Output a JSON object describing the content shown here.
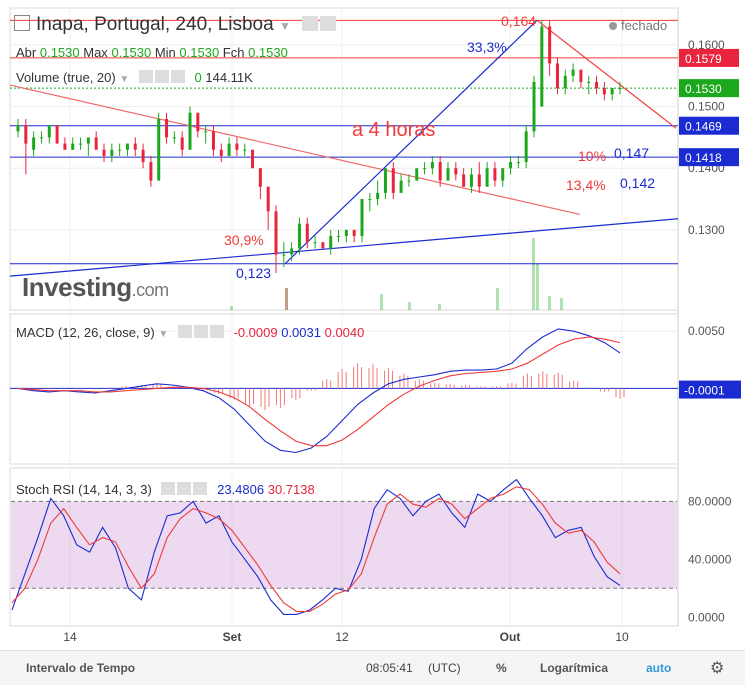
{
  "header": {
    "title": "Inapa, Portugal, 240, Lisboa",
    "status": "fechado",
    "ohlc": {
      "abr_label": "Abr",
      "abr": "0.1530",
      "max_label": "Max",
      "max": "0.1530",
      "min_label": "Min",
      "min": "0.1530",
      "fch_label": "Fch",
      "fch": "0.1530"
    },
    "volume_label": "Volume (true, 20)",
    "volume_v1": "0",
    "volume_v2": "144.11K"
  },
  "annotations": {
    "period_text": "a 4 horas",
    "peak": "0,164",
    "rise_pct": "33,3%",
    "drop_pct": "30,9%",
    "low": "0,123",
    "pct10": "10%",
    "lvl147": "0,147",
    "pct134": "13,4%",
    "lvl142": "0,142"
  },
  "logo": {
    "brand": "Investing",
    "suffix": ".com"
  },
  "price_axis": {
    "ticks": [
      "0.1600",
      "0.1500",
      "0.1400",
      "0.1300"
    ],
    "badges": [
      {
        "label": "0.1579",
        "color": "#e8253c"
      },
      {
        "label": "0.1530",
        "color": "#1ca81c"
      },
      {
        "label": "0.1469",
        "color": "#1a2bd1"
      },
      {
        "label": "0.1418",
        "color": "#1a2bd1"
      }
    ]
  },
  "macd": {
    "label": "MACD (12, 26, close, 9)",
    "v1": "-0.0009",
    "v2": "0.0031",
    "v3": "0.0040",
    "ticks": [
      "0.0050"
    ],
    "badge": "-0.0001"
  },
  "stoch": {
    "label": "Stoch RSI (14, 14, 3, 3)",
    "v1": "23.4806",
    "v2": "30.7138",
    "ticks": [
      "80.0000",
      "40.0000",
      "0.0000"
    ]
  },
  "time_axis": {
    "ticks": [
      "14",
      "Set",
      "12",
      "Out",
      "10"
    ]
  },
  "bottom_bar": {
    "interval": "Intervalo de Tempo",
    "time": "08:05:41",
    "tz": "(UTC)",
    "pct": "%",
    "log": "Logarítmica",
    "auto": "auto"
  },
  "colors": {
    "up": "#1ca81c",
    "down": "#e8253c",
    "blue": "#1a2bd1",
    "red": "#f03a3a"
  },
  "chart_data": [
    {
      "type": "candlestick",
      "name": "price",
      "ylim": [
        0.117,
        0.166
      ],
      "candles": [
        [
          0.146,
          0.148,
          0.145,
          0.147
        ],
        [
          0.147,
          0.148,
          0.139,
          0.144
        ],
        [
          0.143,
          0.146,
          0.142,
          0.145
        ],
        [
          0.145,
          0.146,
          0.144,
          0.145
        ],
        [
          0.145,
          0.147,
          0.144,
          0.147
        ],
        [
          0.147,
          0.147,
          0.144,
          0.144
        ],
        [
          0.144,
          0.145,
          0.143,
          0.143
        ],
        [
          0.143,
          0.145,
          0.143,
          0.144
        ],
        [
          0.144,
          0.145,
          0.143,
          0.144
        ],
        [
          0.144,
          0.145,
          0.142,
          0.145
        ],
        [
          0.145,
          0.146,
          0.143,
          0.143
        ],
        [
          0.143,
          0.144,
          0.141,
          0.142
        ],
        [
          0.142,
          0.144,
          0.141,
          0.143
        ],
        [
          0.143,
          0.144,
          0.142,
          0.143
        ],
        [
          0.143,
          0.144,
          0.142,
          0.144
        ],
        [
          0.144,
          0.145,
          0.142,
          0.143
        ],
        [
          0.143,
          0.144,
          0.14,
          0.141
        ],
        [
          0.141,
          0.142,
          0.137,
          0.138
        ],
        [
          0.138,
          0.149,
          0.138,
          0.148
        ],
        [
          0.148,
          0.149,
          0.144,
          0.145
        ],
        [
          0.145,
          0.146,
          0.144,
          0.145
        ],
        [
          0.145,
          0.146,
          0.142,
          0.143
        ],
        [
          0.143,
          0.15,
          0.143,
          0.149
        ],
        [
          0.149,
          0.149,
          0.145,
          0.146
        ],
        [
          0.146,
          0.147,
          0.144,
          0.146
        ],
        [
          0.146,
          0.147,
          0.142,
          0.143
        ],
        [
          0.143,
          0.144,
          0.141,
          0.142
        ],
        [
          0.142,
          0.145,
          0.142,
          0.144
        ],
        [
          0.144,
          0.145,
          0.142,
          0.143
        ],
        [
          0.143,
          0.144,
          0.142,
          0.143
        ],
        [
          0.143,
          0.143,
          0.14,
          0.14
        ],
        [
          0.14,
          0.14,
          0.135,
          0.137
        ],
        [
          0.137,
          0.137,
          0.13,
          0.133
        ],
        [
          0.133,
          0.134,
          0.123,
          0.126
        ],
        [
          0.126,
          0.128,
          0.124,
          0.126
        ],
        [
          0.126,
          0.128,
          0.125,
          0.127
        ],
        [
          0.127,
          0.132,
          0.126,
          0.131
        ],
        [
          0.131,
          0.132,
          0.127,
          0.128
        ],
        [
          0.128,
          0.129,
          0.127,
          0.128
        ],
        [
          0.128,
          0.128,
          0.127,
          0.127
        ],
        [
          0.127,
          0.13,
          0.126,
          0.129
        ],
        [
          0.129,
          0.13,
          0.128,
          0.129
        ],
        [
          0.129,
          0.13,
          0.128,
          0.13
        ],
        [
          0.13,
          0.13,
          0.128,
          0.129
        ],
        [
          0.129,
          0.135,
          0.128,
          0.135
        ],
        [
          0.135,
          0.136,
          0.133,
          0.135
        ],
        [
          0.135,
          0.138,
          0.134,
          0.136
        ],
        [
          0.136,
          0.14,
          0.135,
          0.14
        ],
        [
          0.14,
          0.141,
          0.135,
          0.136
        ],
        [
          0.136,
          0.139,
          0.136,
          0.138
        ],
        [
          0.138,
          0.139,
          0.137,
          0.138
        ],
        [
          0.138,
          0.14,
          0.138,
          0.14
        ],
        [
          0.14,
          0.141,
          0.139,
          0.14
        ],
        [
          0.14,
          0.142,
          0.139,
          0.141
        ],
        [
          0.141,
          0.142,
          0.137,
          0.138
        ],
        [
          0.138,
          0.141,
          0.138,
          0.14
        ],
        [
          0.14,
          0.141,
          0.138,
          0.139
        ],
        [
          0.139,
          0.14,
          0.137,
          0.137
        ],
        [
          0.137,
          0.14,
          0.136,
          0.139
        ],
        [
          0.139,
          0.141,
          0.136,
          0.137
        ],
        [
          0.137,
          0.141,
          0.137,
          0.14
        ],
        [
          0.14,
          0.141,
          0.137,
          0.138
        ],
        [
          0.138,
          0.14,
          0.137,
          0.14
        ],
        [
          0.14,
          0.142,
          0.139,
          0.141
        ],
        [
          0.141,
          0.142,
          0.14,
          0.141
        ],
        [
          0.141,
          0.147,
          0.14,
          0.146
        ],
        [
          0.146,
          0.155,
          0.145,
          0.154
        ],
        [
          0.15,
          0.164,
          0.15,
          0.163
        ],
        [
          0.163,
          0.164,
          0.155,
          0.157
        ],
        [
          0.157,
          0.158,
          0.152,
          0.153
        ],
        [
          0.153,
          0.156,
          0.152,
          0.155
        ],
        [
          0.155,
          0.157,
          0.154,
          0.156
        ],
        [
          0.156,
          0.156,
          0.153,
          0.154
        ],
        [
          0.154,
          0.155,
          0.152,
          0.154
        ],
        [
          0.154,
          0.155,
          0.152,
          0.153
        ],
        [
          0.153,
          0.154,
          0.151,
          0.152
        ],
        [
          0.152,
          0.153,
          0.151,
          0.153
        ],
        [
          0.153,
          0.154,
          0.152,
          0.153
        ]
      ]
    },
    {
      "type": "line",
      "name": "macd",
      "series": [
        {
          "values": [
            0.0,
            -0.0002,
            -0.0003,
            -0.0002,
            -0.0003,
            -0.0004,
            -0.0002,
            0.0,
            0.0002,
            0.0004,
            0.0003,
            0.0001,
            -0.0002,
            -0.0008,
            -0.0018,
            -0.0032,
            -0.0046,
            -0.0054,
            -0.0056,
            -0.0052,
            -0.0042,
            -0.0028,
            -0.0014,
            -0.0004,
            0.0004,
            0.0008,
            0.001,
            0.0012,
            0.0015,
            0.0016,
            0.0016,
            0.0017,
            0.0022,
            0.0035,
            0.0045,
            0.0052,
            0.005,
            0.0046,
            0.004,
            0.0031
          ]
        },
        {
          "values": [
            0.0,
            -0.0001,
            -0.0002,
            -0.0002,
            -0.0002,
            -0.0003,
            -0.0003,
            -0.0002,
            -0.0001,
            0.0,
            0.0001,
            0.0001,
            0.0,
            -0.0003,
            -0.0008,
            -0.0016,
            -0.0027,
            -0.0037,
            -0.0046,
            -0.005,
            -0.005,
            -0.0045,
            -0.0036,
            -0.0025,
            -0.0014,
            -0.0005,
            0.0002,
            0.0007,
            0.0011,
            0.0013,
            0.0014,
            0.0015,
            0.0017,
            0.0022,
            0.003,
            0.0038,
            0.0043,
            0.0045,
            0.0043,
            0.004
          ]
        }
      ],
      "histogram": [
        0,
        -0.0001,
        -0.0001,
        0,
        -0.0001,
        -0.0001,
        0.0001,
        0.0002,
        0.0003,
        0.0004,
        0.0002,
        0,
        -0.0002,
        -0.0005,
        -0.001,
        -0.0016,
        -0.0019,
        -0.0017,
        -0.001,
        -0.0002,
        0.0008,
        0.0017,
        0.0022,
        0.0021,
        0.0018,
        0.0013,
        0.0008,
        0.0005,
        0.0004,
        0.0003,
        0.0002,
        0.0002,
        0.0005,
        0.0013,
        0.0015,
        0.0014,
        0.0007,
        0.0001,
        -0.0003,
        -0.0009
      ],
      "ylim": [
        -0.0066,
        0.0065
      ]
    },
    {
      "type": "line",
      "name": "stoch_rsi",
      "series": [
        {
          "values": [
            5,
            30,
            55,
            82,
            70,
            50,
            45,
            62,
            48,
            20,
            12,
            45,
            70,
            72,
            80,
            65,
            70,
            52,
            40,
            28,
            12,
            2,
            2,
            5,
            12,
            20,
            18,
            40,
            75,
            88,
            82,
            70,
            80,
            85,
            72,
            62,
            85,
            80,
            88,
            95,
            82,
            70,
            55,
            60,
            62,
            42,
            28,
            22
          ]
        },
        {
          "values": [
            10,
            20,
            40,
            65,
            75,
            62,
            50,
            55,
            52,
            35,
            20,
            30,
            55,
            68,
            75,
            72,
            68,
            60,
            48,
            36,
            22,
            10,
            4,
            4,
            9,
            16,
            19,
            30,
            55,
            78,
            85,
            78,
            76,
            82,
            78,
            68,
            75,
            82,
            85,
            90,
            88,
            78,
            65,
            58,
            60,
            52,
            38,
            30
          ]
        }
      ],
      "band": [
        20,
        80
      ],
      "ylim": [
        -6,
        103
      ]
    }
  ]
}
